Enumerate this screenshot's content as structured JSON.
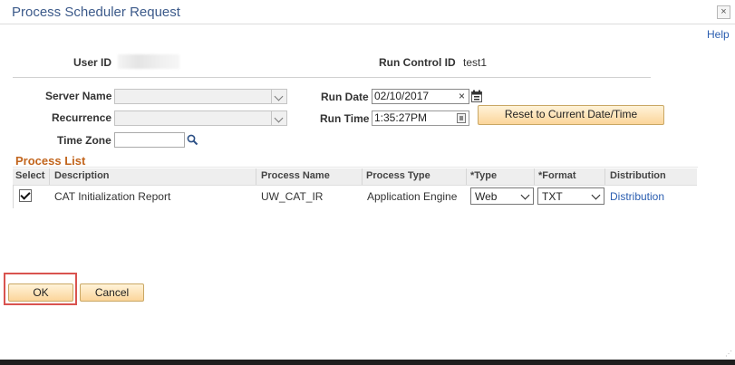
{
  "window": {
    "title": "Process Scheduler Request",
    "close_label": "×",
    "help_label": "Help"
  },
  "header": {
    "user_id_label": "User ID",
    "user_id_value": "",
    "run_control_label": "Run Control ID",
    "run_control_value": "test1"
  },
  "form": {
    "server_name_label": "Server Name",
    "server_name_value": "",
    "recurrence_label": "Recurrence",
    "recurrence_value": "",
    "time_zone_label": "Time Zone",
    "time_zone_value": "",
    "run_date_label": "Run Date",
    "run_date_value": "02/10/2017",
    "run_time_label": "Run Time",
    "run_time_value": "1:35:27PM",
    "reset_button_label": "Reset to Current Date/Time",
    "clear_icon": "×"
  },
  "process_list": {
    "title": "Process List",
    "columns": [
      "Select",
      "Description",
      "Process Name",
      "Process Type",
      "*Type",
      "*Format",
      "Distribution"
    ],
    "rows": [
      {
        "selected": true,
        "description": "CAT Initialization Report",
        "process_name": "UW_CAT_IR",
        "process_type": "Application Engine",
        "type": "Web",
        "format": "TXT",
        "distribution": "Distribution"
      }
    ]
  },
  "actions": {
    "ok_label": "OK",
    "cancel_label": "Cancel"
  },
  "colors": {
    "title": "#3c5a8a",
    "section_title": "#c2651d",
    "link": "#2a5db0",
    "button_fill": "#fbd59a",
    "highlight": "#d9534f"
  },
  "icons": {
    "lookup": "magnifier-icon",
    "calendar": "calendar-icon",
    "time_picker": "clock-icon",
    "close": "close-icon"
  }
}
